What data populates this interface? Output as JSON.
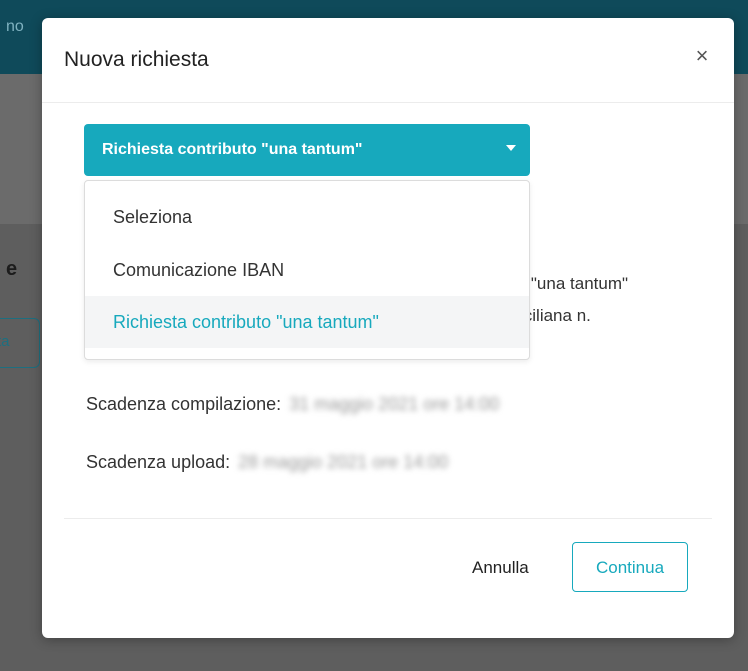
{
  "background": {
    "topbar_text": "no",
    "partial_letter": "e",
    "partial_button_label": "ta"
  },
  "modal": {
    "title": "Nuova richiesta",
    "close_icon": "×",
    "select": {
      "selected": "Richiesta contributo \"una tantum\"",
      "options": [
        "Seleziona",
        "Comunicazione IBAN",
        "Richiesta contributo \"una tantum\""
      ]
    },
    "partial_text": {
      "line1": "to \"una tantum\"",
      "line2": "iciliana n."
    },
    "info": {
      "compilazione_label": "Scadenza compilazione:",
      "compilazione_value": "31 maggio 2021 ore 14:00",
      "upload_label": "Scadenza upload:",
      "upload_value": "28 maggio 2021 ore 14:00"
    },
    "footer": {
      "cancel": "Annulla",
      "continue": "Continua"
    }
  },
  "colors": {
    "accent": "#17a9bd",
    "topbar": "#0f4a5a"
  }
}
